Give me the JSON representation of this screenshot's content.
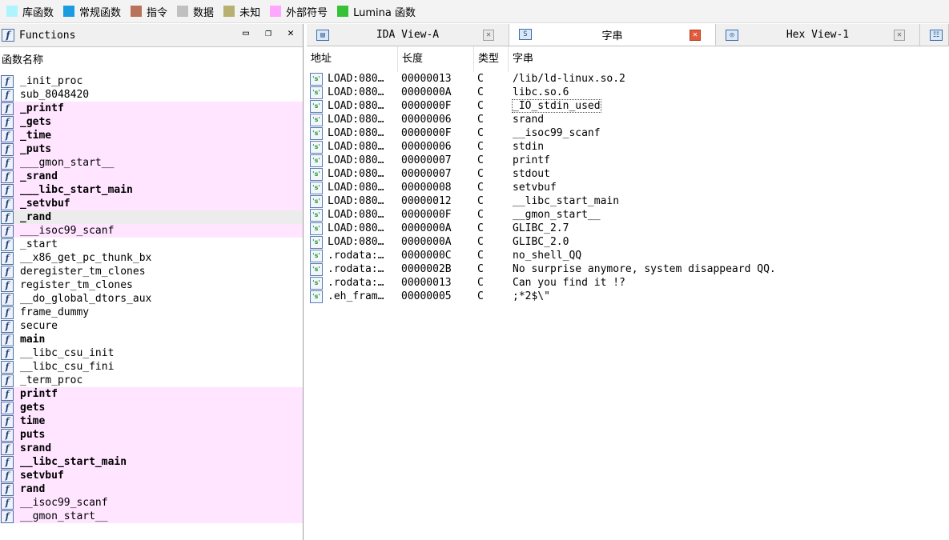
{
  "legend": [
    {
      "label": "库函数",
      "color": "#aef4ff"
    },
    {
      "label": "常规函数",
      "color": "#1a9de0"
    },
    {
      "label": "指令",
      "color": "#b8735a"
    },
    {
      "label": "数据",
      "color": "#c0c0c0"
    },
    {
      "label": "未知",
      "color": "#b8b070"
    },
    {
      "label": "外部符号",
      "color": "#ffa6ff"
    },
    {
      "label": "Lumina 函数",
      "color": "#36c236"
    }
  ],
  "functions_panel": {
    "title": "Functions",
    "column_header": "函数名称",
    "items": [
      {
        "name": "_init_proc",
        "bold": false,
        "style": "normal"
      },
      {
        "name": "sub_8048420",
        "bold": false,
        "style": "normal"
      },
      {
        "name": "_printf",
        "bold": true,
        "style": "pink"
      },
      {
        "name": "_gets",
        "bold": true,
        "style": "pink"
      },
      {
        "name": "_time",
        "bold": true,
        "style": "pink"
      },
      {
        "name": "_puts",
        "bold": true,
        "style": "pink"
      },
      {
        "name": "___gmon_start__",
        "bold": false,
        "style": "pink"
      },
      {
        "name": "_srand",
        "bold": true,
        "style": "pink"
      },
      {
        "name": "___libc_start_main",
        "bold": true,
        "style": "pink"
      },
      {
        "name": "_setvbuf",
        "bold": true,
        "style": "pink"
      },
      {
        "name": "_rand",
        "bold": true,
        "style": "selected"
      },
      {
        "name": "___isoc99_scanf",
        "bold": false,
        "style": "pink"
      },
      {
        "name": "_start",
        "bold": false,
        "style": "normal"
      },
      {
        "name": "__x86_get_pc_thunk_bx",
        "bold": false,
        "style": "normal"
      },
      {
        "name": "deregister_tm_clones",
        "bold": false,
        "style": "normal"
      },
      {
        "name": "register_tm_clones",
        "bold": false,
        "style": "normal"
      },
      {
        "name": "__do_global_dtors_aux",
        "bold": false,
        "style": "normal"
      },
      {
        "name": "frame_dummy",
        "bold": false,
        "style": "normal"
      },
      {
        "name": "secure",
        "bold": false,
        "style": "normal"
      },
      {
        "name": "main",
        "bold": true,
        "style": "normal"
      },
      {
        "name": "__libc_csu_init",
        "bold": false,
        "style": "normal"
      },
      {
        "name": "__libc_csu_fini",
        "bold": false,
        "style": "normal"
      },
      {
        "name": "_term_proc",
        "bold": false,
        "style": "normal"
      },
      {
        "name": "printf",
        "bold": true,
        "style": "pink"
      },
      {
        "name": "gets",
        "bold": true,
        "style": "pink"
      },
      {
        "name": "time",
        "bold": true,
        "style": "pink"
      },
      {
        "name": "puts",
        "bold": true,
        "style": "pink"
      },
      {
        "name": "srand",
        "bold": true,
        "style": "pink"
      },
      {
        "name": "__libc_start_main",
        "bold": true,
        "style": "pink"
      },
      {
        "name": "setvbuf",
        "bold": true,
        "style": "pink"
      },
      {
        "name": "rand",
        "bold": true,
        "style": "pink"
      },
      {
        "name": "__isoc99_scanf",
        "bold": false,
        "style": "pink"
      },
      {
        "name": "__gmon_start__",
        "bold": false,
        "style": "pink"
      }
    ]
  },
  "tabs": [
    {
      "label": "IDA View-A",
      "active": false
    },
    {
      "label": "字串",
      "active": true
    },
    {
      "label": "Hex View-1",
      "active": false
    }
  ],
  "strings_table": {
    "headers": {
      "addr": "地址",
      "len": "长度",
      "type": "类型",
      "str": "字串"
    },
    "rows": [
      {
        "addr": "LOAD:080…",
        "len": "00000013",
        "type": "C",
        "str": "/lib/ld-linux.so.2"
      },
      {
        "addr": "LOAD:080…",
        "len": "0000000A",
        "type": "C",
        "str": "libc.so.6"
      },
      {
        "addr": "LOAD:080…",
        "len": "0000000F",
        "type": "C",
        "str": "_IO_stdin_used"
      },
      {
        "addr": "LOAD:080…",
        "len": "00000006",
        "type": "C",
        "str": "srand"
      },
      {
        "addr": "LOAD:080…",
        "len": "0000000F",
        "type": "C",
        "str": "__isoc99_scanf"
      },
      {
        "addr": "LOAD:080…",
        "len": "00000006",
        "type": "C",
        "str": "stdin"
      },
      {
        "addr": "LOAD:080…",
        "len": "00000007",
        "type": "C",
        "str": "printf"
      },
      {
        "addr": "LOAD:080…",
        "len": "00000007",
        "type": "C",
        "str": "stdout"
      },
      {
        "addr": "LOAD:080…",
        "len": "00000008",
        "type": "C",
        "str": "setvbuf"
      },
      {
        "addr": "LOAD:080…",
        "len": "00000012",
        "type": "C",
        "str": "__libc_start_main"
      },
      {
        "addr": "LOAD:080…",
        "len": "0000000F",
        "type": "C",
        "str": "__gmon_start__"
      },
      {
        "addr": "LOAD:080…",
        "len": "0000000A",
        "type": "C",
        "str": "GLIBC_2.7"
      },
      {
        "addr": "LOAD:080…",
        "len": "0000000A",
        "type": "C",
        "str": "GLIBC_2.0"
      },
      {
        "addr": ".rodata:…",
        "len": "0000000C",
        "type": "C",
        "str": "no_shell_QQ"
      },
      {
        "addr": ".rodata:…",
        "len": "0000002B",
        "type": "C",
        "str": "No surprise anymore, system disappeard QQ."
      },
      {
        "addr": ".rodata:…",
        "len": "00000013",
        "type": "C",
        "str": "Can you find it !?"
      },
      {
        "addr": ".eh_fram…",
        "len": "00000005",
        "type": "C",
        "str": ";*2$\\\""
      }
    ]
  }
}
